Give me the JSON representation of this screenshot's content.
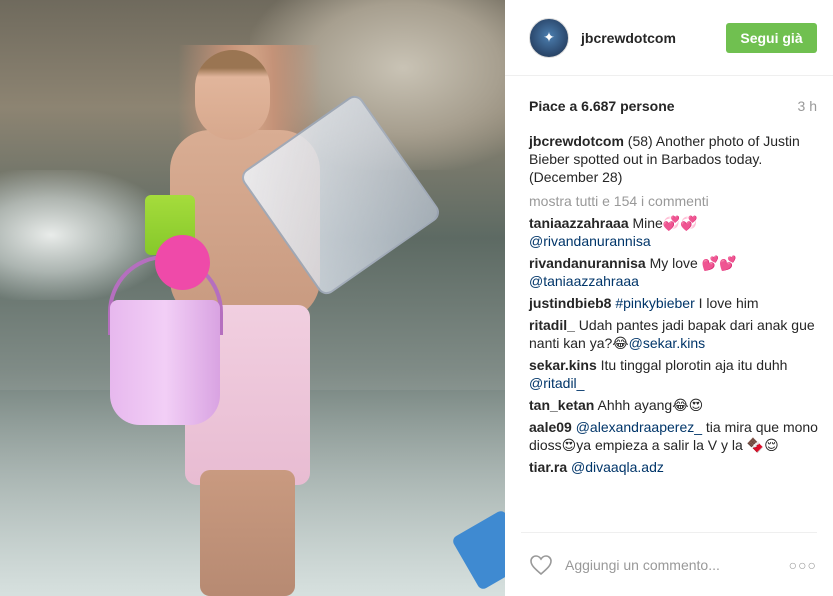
{
  "post": {
    "image_alt_icon": "photo",
    "header": {
      "username": "jbcrewdotcom",
      "follow_label": "Segui già",
      "follow_color": "#70c050"
    },
    "likes_label": "Piace a 6.687 persone",
    "time_label": "3 h",
    "caption": {
      "username": "jbcrewdotcom",
      "text": "(58) Another photo of Justin Bieber spotted out in Barbados today. (December 28)"
    },
    "show_all_label": "mostra tutti e 154 i commenti",
    "comments": [
      {
        "username": "taniaazzahraaa",
        "text": "Mine💞💞 ",
        "mention": "@rivandanurannisa",
        "after": ""
      },
      {
        "username": "rivandanurannisa",
        "text": "My love 💕💕 ",
        "mention": "@taniaazzahraaa",
        "after": ""
      },
      {
        "username": "justindbieb8",
        "text": "",
        "mention": "#pinkybieber",
        "after": " I love him"
      },
      {
        "username": "ritadil_",
        "text": "Udah pantes jadi bapak dari anak gue nanti kan ya?😂",
        "mention": "@sekar.kins",
        "after": ""
      },
      {
        "username": "sekar.kins",
        "text": "Itu tinggal plorotin aja itu duhh ",
        "mention": "@ritadil_",
        "after": ""
      },
      {
        "username": "tan_ketan",
        "text": "Ahhh ayang😂😍",
        "mention": "",
        "after": ""
      },
      {
        "username": "aale09",
        "text": "",
        "mention": "@alexandraaperez_",
        "after": " tia mira que mono dioss😍ya empieza a salir la V y la 🍫😌"
      },
      {
        "username": "tiar.ra",
        "text": "",
        "mention": "@divaaqla.adz",
        "after": ""
      }
    ],
    "footer": {
      "like_icon": "heart-icon",
      "comment_placeholder": "Aggiungi un commento...",
      "options_label": "○○○"
    }
  }
}
